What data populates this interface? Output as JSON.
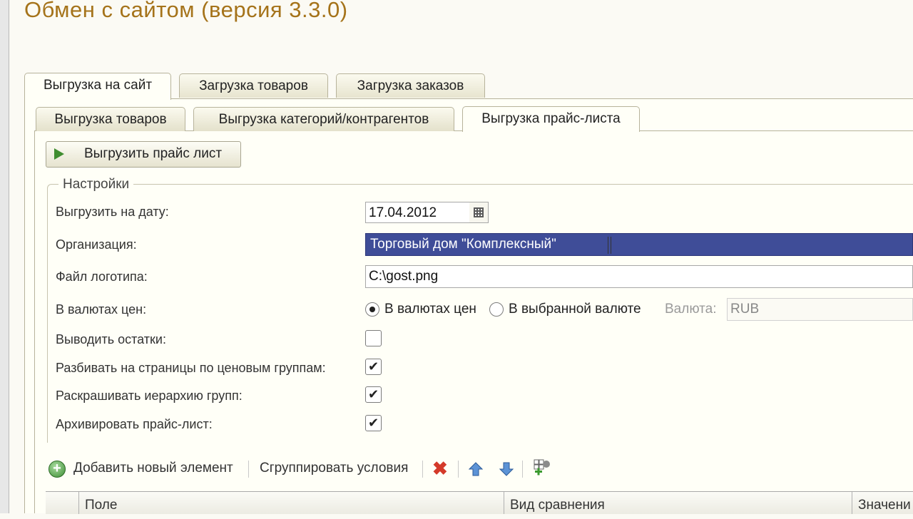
{
  "window": {
    "title": "Обмен с сайтом (версия 3.3.0)"
  },
  "tabs_top": [
    {
      "label": "Выгрузка на сайт",
      "active": true
    },
    {
      "label": "Загрузка товаров",
      "active": false
    },
    {
      "label": "Загрузка заказов",
      "active": false
    }
  ],
  "tabs_mid": [
    {
      "label": "Выгрузка товаров",
      "active": false
    },
    {
      "label": "Выгрузка категорий/контрагентов",
      "active": false
    },
    {
      "label": "Выгрузка прайс-листа",
      "active": true
    }
  ],
  "export_button": {
    "label": "Выгрузить прайс лист",
    "icon": "play-icon"
  },
  "settings": {
    "legend": "Настройки",
    "date": {
      "label": "Выгрузить на дату:",
      "value": "17.04.2012",
      "icon": "calendar-icon"
    },
    "organization": {
      "label": "Организация:",
      "value": "Торговый дом \"Комплексный\""
    },
    "logo_file": {
      "label": "Файл логотипа:",
      "value": "C:\\gost.png"
    },
    "currency_mode": {
      "label": "В валютах цен:",
      "options": [
        {
          "label": "В валютах цен",
          "selected": true
        },
        {
          "label": "В выбранной валюте",
          "selected": false
        }
      ],
      "currency_label": "Валюта:",
      "currency_value": "RUB"
    },
    "show_stock": {
      "label": "Выводить остатки:",
      "checked": false
    },
    "split_by_price_groups": {
      "label": "Разбивать на страницы по ценовым группам:",
      "checked": true
    },
    "color_hierarchy": {
      "label": "Раскрашивать иерархию групп:",
      "checked": true
    },
    "archive_price_list": {
      "label": "Архивировать прайс-лист:",
      "checked": true
    }
  },
  "check_mark": "✔",
  "toolbar": {
    "add_label": "Добавить новый элемент",
    "group_label": "Сгруппировать условия",
    "icons": [
      "add-icon",
      "delete-icon",
      "move-up-icon",
      "move-down-icon",
      "add-group-icon"
    ]
  },
  "table": {
    "columns": [
      "Поле",
      "Вид сравнения",
      "Значени"
    ]
  },
  "colors": {
    "title": "#a5731a",
    "selection": "#3f4d98",
    "panel": "#fffff7"
  }
}
